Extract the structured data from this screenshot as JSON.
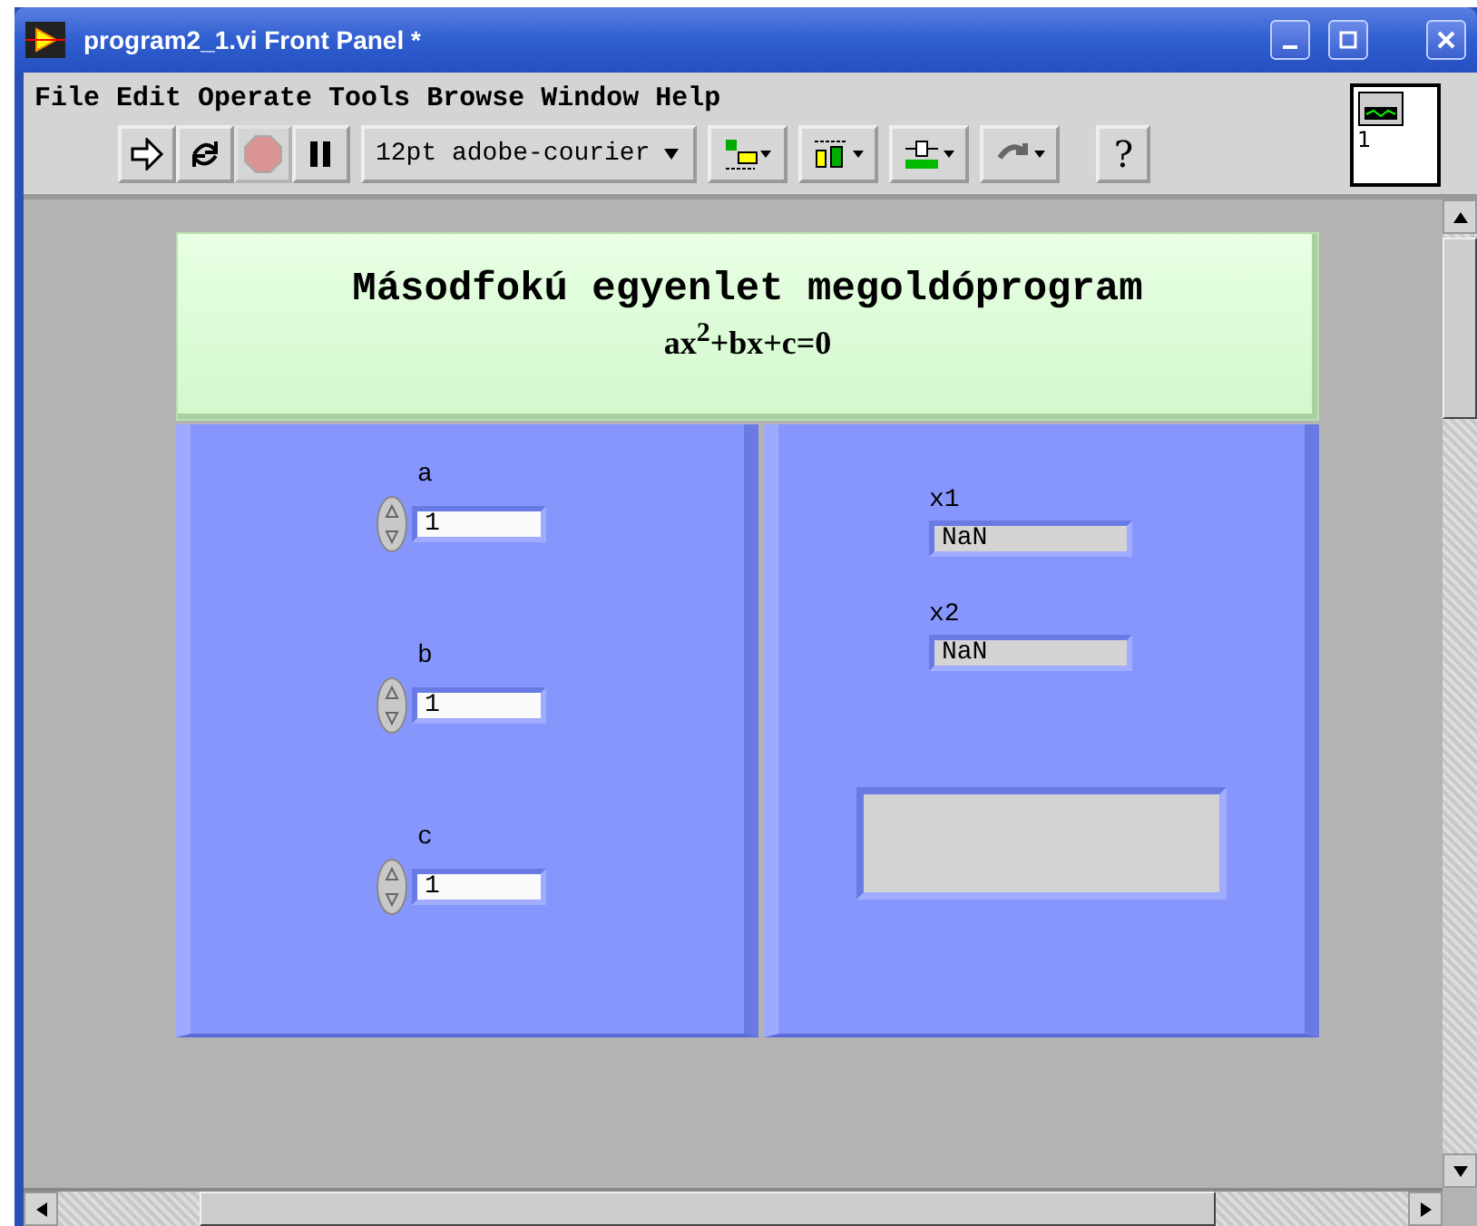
{
  "window": {
    "title": "program2_1.vi Front Panel *"
  },
  "menu": [
    "File",
    "Edit",
    "Operate",
    "Tools",
    "Browse",
    "Window",
    "Help"
  ],
  "toolbar": {
    "buttons": [
      {
        "kind": "run",
        "disabled": false
      },
      {
        "kind": "continuous",
        "disabled": false
      },
      {
        "kind": "abort",
        "disabled": true
      },
      {
        "kind": "pause",
        "disabled": false
      }
    ],
    "font": "12pt adobe-courier",
    "tools": [
      {
        "kind": "align"
      },
      {
        "kind": "distribute"
      },
      {
        "kind": "resize"
      },
      {
        "kind": "reorder"
      }
    ],
    "help": "?"
  },
  "connector": {
    "label": "1"
  },
  "panel": {
    "title": "Másodfokú egyenlet megoldóprogram",
    "equation": "ax$^{2}$+bx+c=0",
    "controls": [
      {
        "label": "a",
        "value": "1"
      },
      {
        "label": "b",
        "value": "1"
      },
      {
        "label": "c",
        "value": "1"
      }
    ],
    "indicators": [
      {
        "label": "x1",
        "value": "NaN"
      },
      {
        "label": "x2",
        "value": "NaN"
      }
    ]
  }
}
